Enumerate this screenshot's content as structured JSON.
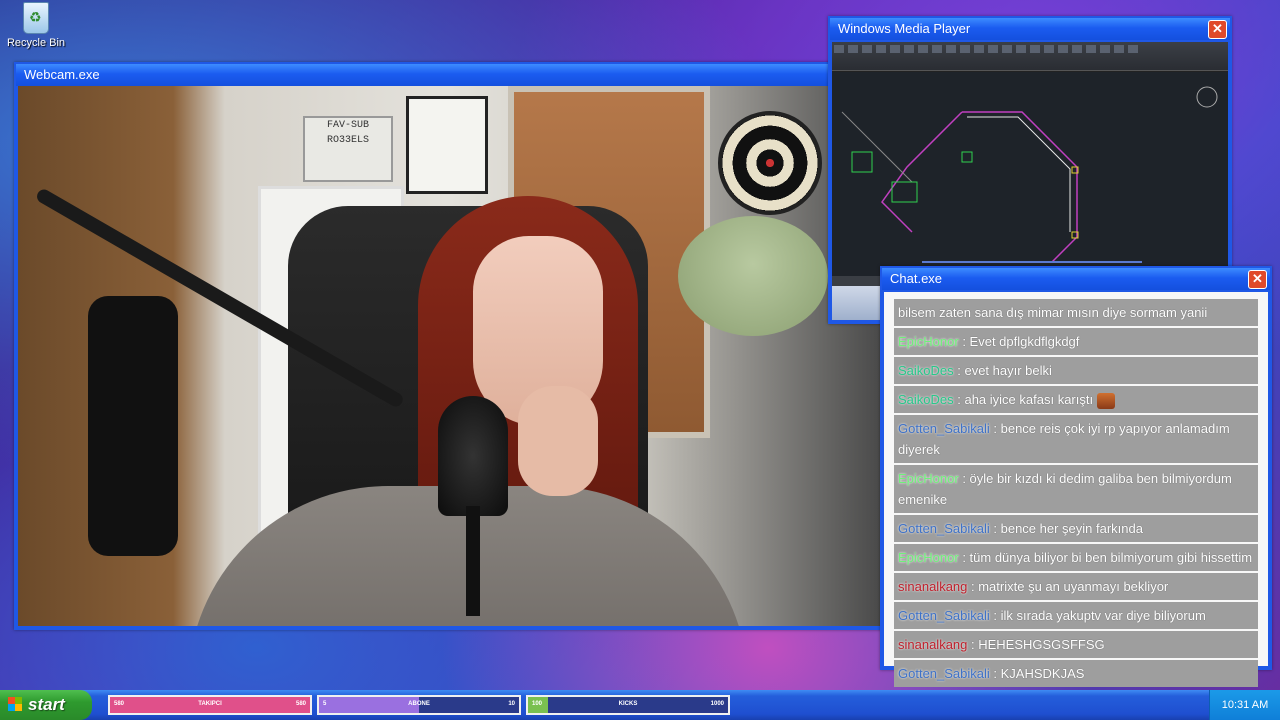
{
  "desktop": {
    "recycle_bin_label": "Recycle Bin"
  },
  "webcam_window": {
    "title": "Webcam.exe",
    "sign_lines": [
      "FAV-SUB",
      "RO33ELS"
    ]
  },
  "media_player_window": {
    "title": "Windows Media Player"
  },
  "chat_window": {
    "title": "Chat.exe",
    "messages": [
      {
        "user": "",
        "text": "bilsem zaten sana dış mimar mısın diye sormam yanii",
        "user_color": "#ffffff"
      },
      {
        "user": "EpicHonor",
        "text": " : Evet dpflgkdflgkdgf",
        "user_color": "#6ff07a"
      },
      {
        "user": "SaikoDes",
        "text": " : evet hayır belki",
        "user_color": "#27c88a"
      },
      {
        "user": "SaikoDes",
        "text": " : aha iyice kafası karıştı",
        "user_color": "#27c88a",
        "emote": "face-emote-icon"
      },
      {
        "user": "Gotten_Sabikali",
        "text": " : bence reis çok iyi rp yapıyor anlamadım diyerek",
        "user_color": "#3f72c8"
      },
      {
        "user": "EpicHonor",
        "text": " : öyle bir kızdı ki dedim galiba ben bilmiyordum emenike",
        "user_color": "#6ff07a"
      },
      {
        "user": "Gotten_Sabikali",
        "text": " : bence her şeyin farkında",
        "user_color": "#3f72c8"
      },
      {
        "user": "EpicHonor",
        "text": " : tüm dünya biliyor bi ben bilmiyorum gibi hissettim",
        "user_color": "#6ff07a"
      },
      {
        "user": "sinanalkang",
        "text": " : matrixte şu an uyanmayı bekliyor",
        "user_color": "#c0202c"
      },
      {
        "user": "Gotten_Sabikali",
        "text": " : ilk sırada yakuptv var diye biliyorum",
        "user_color": "#3f72c8"
      },
      {
        "user": "sinanalkang",
        "text": " : HEHESHGSGSFFSG",
        "user_color": "#c0202c"
      },
      {
        "user": "Gotten_Sabikali",
        "text": " : KJAHSDKJAS",
        "user_color": "#3f72c8"
      }
    ]
  },
  "taskbar": {
    "start_label": "start",
    "bars": [
      {
        "left": "580",
        "label": "TAKIPCI",
        "right": "580",
        "progress": 1.0,
        "color": "#e0508a",
        "name": "followers-goal-bar"
      },
      {
        "left": "5",
        "label": "ABONE",
        "right": "10",
        "progress": 0.5,
        "color": "#9a70e0",
        "name": "subscribers-goal-bar"
      },
      {
        "left": "100",
        "label": "KICKS",
        "right": "1000",
        "progress": 0.1,
        "color": "#7ac050",
        "name": "kicks-goal-bar"
      }
    ],
    "clock": "10:31 AM"
  }
}
